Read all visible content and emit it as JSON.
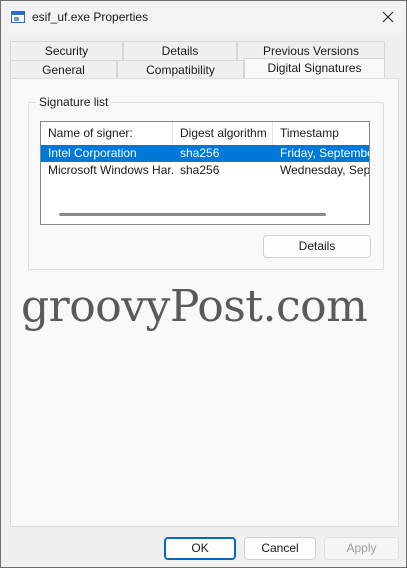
{
  "window": {
    "title": "esif_uf.exe Properties",
    "close_symbol": "×"
  },
  "tabs": {
    "row1": [
      {
        "label": "Security"
      },
      {
        "label": "Details"
      },
      {
        "label": "Previous Versions"
      }
    ],
    "row2": [
      {
        "label": "General"
      },
      {
        "label": "Compatibility"
      },
      {
        "label": "Digital Signatures",
        "active": true
      }
    ]
  },
  "signature_list": {
    "group_label": "Signature list",
    "columns": [
      "Name of signer:",
      "Digest algorithm",
      "Timestamp"
    ],
    "rows": [
      {
        "signer": "Intel Corporation",
        "digest": "sha256",
        "timestamp": "Friday, September",
        "selected": true
      },
      {
        "signer": "Microsoft Windows Har...",
        "digest": "sha256",
        "timestamp": "Wednesday, Septe",
        "selected": false
      }
    ],
    "details_button": "Details"
  },
  "watermark": "groovyPost.com",
  "footer": {
    "ok": "OK",
    "cancel": "Cancel",
    "apply": "Apply"
  },
  "colors": {
    "selection": "#0078d7",
    "primary_border": "#0067c0"
  },
  "icons": {
    "app": "window-app-icon",
    "close": "close-icon"
  }
}
